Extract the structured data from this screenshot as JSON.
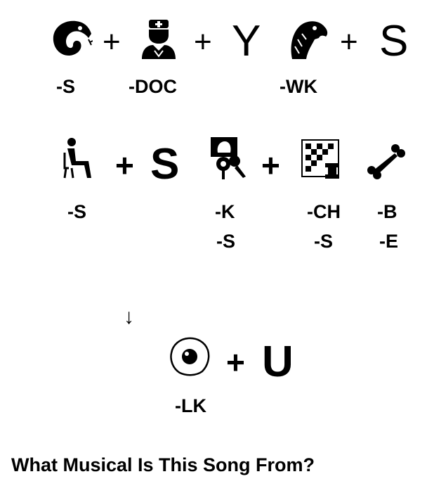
{
  "puzzle": {
    "row1": {
      "icons": [
        "snake-icon",
        "doctor-icon",
        "eagle-head-icon"
      ],
      "operators": [
        "+",
        "+",
        "+"
      ],
      "letters": [
        "Y",
        "S"
      ],
      "removals": [
        "-S",
        "-DOC",
        "-WK"
      ]
    },
    "row2": {
      "icons": [
        "seated-person-icon",
        "key-finder-icon",
        "chessboard-icon",
        "bone-icon"
      ],
      "operators": [
        "+",
        "+"
      ],
      "letters": [
        "S"
      ],
      "removals": [
        "-S",
        "-K",
        "-S",
        "-CH",
        "-S",
        "-B",
        "-E"
      ]
    },
    "arrow": "↓",
    "row3": {
      "icons": [
        "fried-egg-icon"
      ],
      "operators": [
        "+"
      ],
      "letters": [
        "U"
      ],
      "removals": [
        "-LK"
      ]
    },
    "question": "What Musical Is This Song From?"
  },
  "colors": {
    "ink": "#000000",
    "background": "#ffffff"
  }
}
